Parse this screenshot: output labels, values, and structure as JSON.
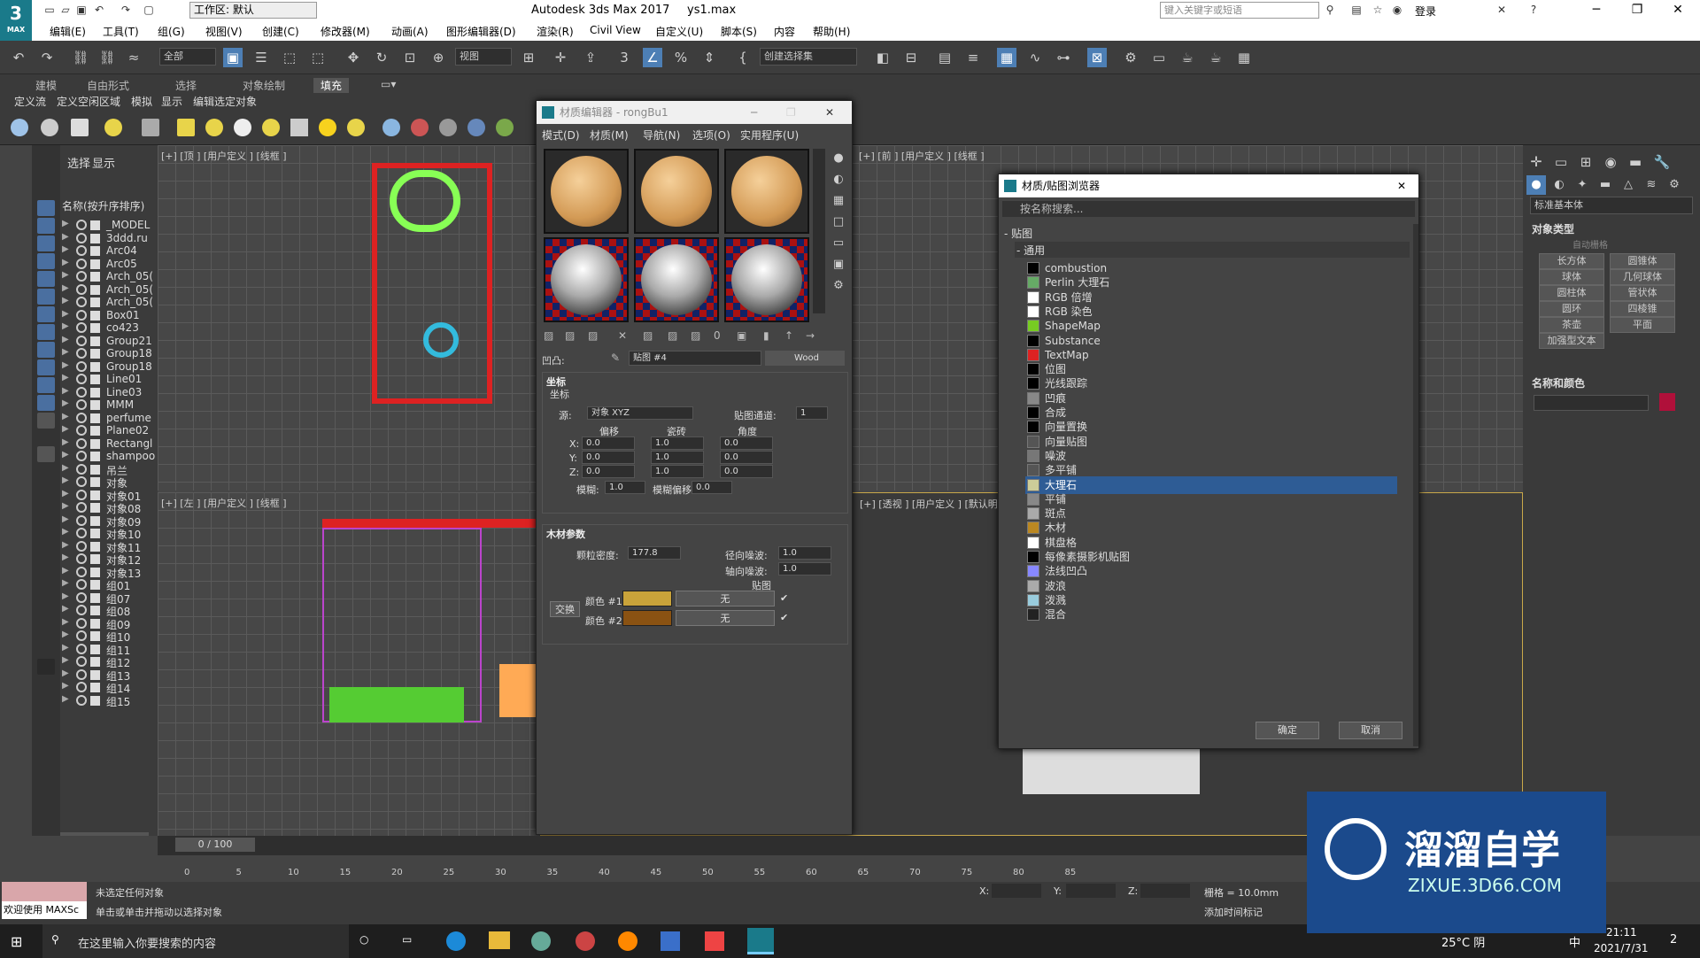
{
  "app": {
    "logo": "3",
    "logo_sub": "MAX",
    "title": "Autodesk 3ds Max 2017",
    "file": "ys1.max",
    "workspace": "工作区: 默认",
    "search_placeholder": "键入关键字或短语",
    "login": "登录"
  },
  "menu": [
    "编辑(E)",
    "工具(T)",
    "组(G)",
    "视图(V)",
    "创建(C)",
    "修改器(M)",
    "动画(A)",
    "图形编辑器(D)",
    "渲染(R)",
    "Civil View",
    "自定义(U)",
    "脚本(S)",
    "内容",
    "帮助(H)"
  ],
  "toolbar": {
    "filter": "全部",
    "view": "视图",
    "selset": "创建选择集"
  },
  "ribbon": {
    "tabs": [
      "建模",
      "自由形式",
      "选择",
      "对象绘制",
      "填充"
    ],
    "sub": [
      "定义流",
      "定义空闲区域",
      "模拟",
      "显示",
      "编辑选定对象"
    ]
  },
  "scene": {
    "tab_select": "选择",
    "tab_display": "显示",
    "sort": "名称(按升序排序)",
    "items": [
      "_MODEL",
      "3ddd.ru",
      "Arc04",
      "Arc05",
      "Arch_05(",
      "Arch_05(",
      "Arch_05(",
      "Box01",
      "co423",
      "Group21",
      "Group18",
      "Group18",
      "Line01",
      "Line03",
      "MMM",
      "perfume",
      "Plane02",
      "Rectangl",
      "shampoo",
      "吊兰",
      "对象",
      "对象01",
      "对象08",
      "对象09",
      "对象10",
      "对象11",
      "对象12",
      "对象13",
      "组01",
      "组07",
      "组08",
      "组09",
      "组10",
      "组11",
      "组12",
      "组13",
      "组14",
      "组15"
    ]
  },
  "viewports": {
    "top": "[+] [顶 ] [用户定义 ] [线框 ]",
    "left": "[+] [左 ] [用户定义 ] [线框 ]",
    "front": "[+] [前 ] [用户定义 ] [线框 ]",
    "persp": "[+] [透视 ] [用户定义 ] [默认明暗处理 ]"
  },
  "mat_editor": {
    "title": "材质编辑器 - rongBu1",
    "menu": [
      "模式(D)",
      "材质(M)",
      "导航(N)",
      "选项(O)",
      "实用程序(U)"
    ],
    "slot_name": "贴图 #4",
    "slot_type": "Wood",
    "map_label": "凹凸:",
    "coord_rollup": "坐标",
    "coord_sub": "坐标",
    "source_label": "源:",
    "source_value": "对象 XYZ",
    "channel_label": "贴图通道:",
    "channel_value": "1",
    "offset": "偏移",
    "tiling": "瓷砖",
    "angle": "角度",
    "axes": [
      "X:",
      "Y:",
      "Z:"
    ],
    "offset_vals": [
      "0.0",
      "0.0",
      "0.0"
    ],
    "tiling_vals": [
      "1.0",
      "1.0",
      "1.0"
    ],
    "angle_vals": [
      "0.0",
      "0.0",
      "0.0"
    ],
    "blur_label": "模糊:",
    "blur": "1.0",
    "blur_off_label": "模糊偏移:",
    "blur_off": "0.0",
    "wood_rollup": "木材参数",
    "grain_label": "颗粒密度:",
    "grain": "177.8",
    "radial_label": "径向噪波:",
    "radial": "1.0",
    "axial_label": "轴向噪波:",
    "axial": "1.0",
    "maps_label": "贴图",
    "swap": "交换",
    "color1_label": "颜色 #1",
    "color2_label": "颜色 #2",
    "none1": "无",
    "none2": "无",
    "color1": "#c9a33a",
    "color2": "#8a5212"
  },
  "browser": {
    "title": "材质/贴图浏览器",
    "search": "按名称搜索...",
    "group": "- 贴图",
    "subgroup": "- 通用",
    "ok": "确定",
    "cancel": "取消",
    "maps": [
      "combustion",
      "Perlin 大理石",
      "RGB 倍增",
      "RGB 染色",
      "ShapeMap",
      "Substance",
      "TextMap",
      "位图",
      "光线跟踪",
      "凹痕",
      "合成",
      "向量置换",
      "向量贴图",
      "噪波",
      "多平铺",
      "大理石",
      "平铺",
      "斑点",
      "木材",
      "棋盘格",
      "每像素摄影机贴图",
      "法线凹凸",
      "波浪",
      "泼溅",
      "混合"
    ],
    "selected": "大理石"
  },
  "cmd": {
    "std": "标准基本体",
    "obj_type": "对象类型",
    "autogrid": "自动栅格",
    "buttons": [
      "长方体",
      "圆锥体",
      "球体",
      "几何球体",
      "圆柱体",
      "管状体",
      "圆环",
      "四棱锥",
      "茶壶",
      "平面",
      "加强型文本"
    ],
    "name_color": "名称和颜色",
    "color": "#b0103a"
  },
  "time": {
    "frame": "0 / 100",
    "ticks": [
      "0",
      "5",
      "10",
      "15",
      "20",
      "25",
      "30",
      "35",
      "40",
      "45",
      "50",
      "55",
      "60",
      "65",
      "70",
      "75",
      "80",
      "85"
    ]
  },
  "status": {
    "welcome": "欢迎使用 MAXSc",
    "msg1": "未选定任何对象",
    "msg2": "单击或单击并拖动以选择对象",
    "x": "X:",
    "y": "Y:",
    "z": "Z:",
    "grid": "栅格 = 10.0mm",
    "addtime": "添加时间标记"
  },
  "taskbar": {
    "search": "在这里输入你要搜索的内容",
    "weather": "25°C 阴",
    "ime": "中",
    "time": "21:11",
    "date": "2021/7/31",
    "notif": "2"
  },
  "watermark": {
    "brand": "溜溜自学",
    "url": "ZIXUE.3D66.COM"
  }
}
